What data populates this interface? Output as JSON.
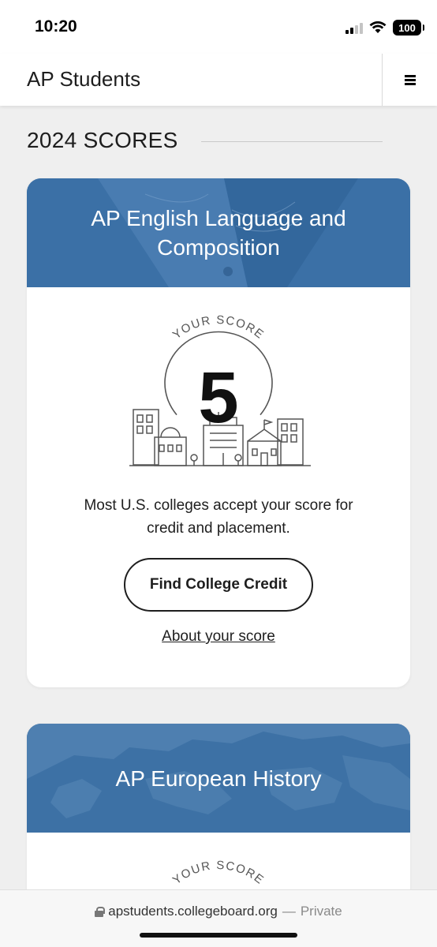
{
  "status_bar": {
    "time": "10:20",
    "battery": "100",
    "icons": [
      "cellular-signal-icon",
      "wifi-icon",
      "battery-icon"
    ]
  },
  "header": {
    "title": "AP Students",
    "menu_icon": "hamburger-menu-icon"
  },
  "section": {
    "heading": "2024 SCORES"
  },
  "scores": [
    {
      "subject": "AP English Language and Composition",
      "score_caption": "YOUR SCORE",
      "score": "5",
      "message": "Most U.S. colleges accept your score for credit and placement.",
      "cta_label": "Find College Credit",
      "link_label": "About your score",
      "banner_image": "open-book-image"
    },
    {
      "subject": "AP European History",
      "score_caption": "YOUR SCORE",
      "banner_image": "europe-map-image"
    }
  ],
  "browser": {
    "url": "apstudents.collegeboard.org",
    "separator": "—",
    "mode": "Private"
  },
  "colors": {
    "banner_blue": "#3a6ea4",
    "page_bg": "#efefef",
    "text": "#1e1e1e"
  }
}
